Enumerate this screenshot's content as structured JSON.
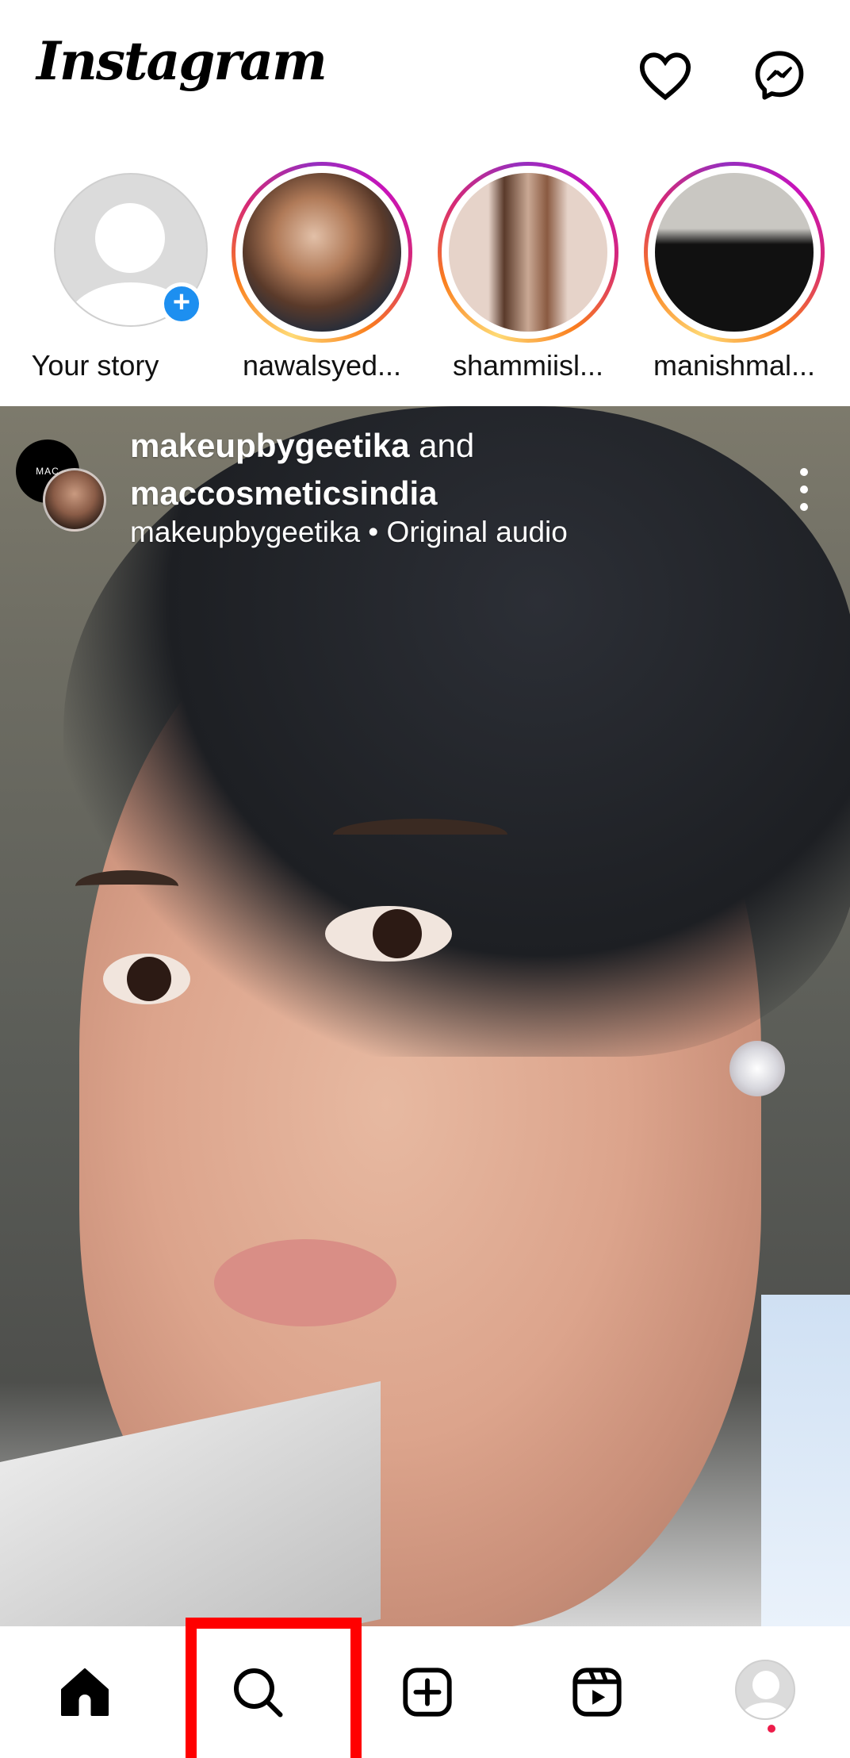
{
  "app": {
    "logo": "Instagram"
  },
  "header": {
    "icons": [
      "heart-icon",
      "messenger-icon"
    ]
  },
  "stories": [
    {
      "label": "Your story",
      "type": "own",
      "add_badge": "+"
    },
    {
      "label": "nawalsyed...",
      "type": "unseen",
      "photo_colors": [
        "#1b2a3d",
        "#b07a58",
        "#e2c0a8"
      ]
    },
    {
      "label": "shammiisl...",
      "type": "unseen",
      "photo_colors": [
        "#e6d3c9",
        "#8a5a41",
        "#c9a894"
      ]
    },
    {
      "label": "manishmal...",
      "type": "unseen",
      "photo_colors": [
        "#c9c7c2",
        "#f2f0ec",
        "#111111"
      ]
    }
  ],
  "post": {
    "author_primary": "makeupbygeetika",
    "joiner": "and",
    "author_secondary": "maccosmeticsindia",
    "audio_line": "makeupbygeetika • Original audio",
    "collab_logo_text": "MAC",
    "media_description": "Close-up video frame of a woman's face with hair pulled back and a diamond earring"
  },
  "bottom_nav": {
    "items": [
      {
        "name": "home",
        "icon": "home-icon",
        "active": true
      },
      {
        "name": "search",
        "icon": "search-icon",
        "active": false
      },
      {
        "name": "create",
        "icon": "add-post-icon",
        "active": false
      },
      {
        "name": "reels",
        "icon": "reels-icon",
        "active": false
      },
      {
        "name": "profile",
        "icon": "profile-avatar-icon",
        "active": false,
        "notification_dot": true
      }
    ]
  },
  "annotation": {
    "highlighted_item": "search",
    "color": "#ff0000"
  },
  "colors": {
    "story_ring": [
      "#feda75",
      "#fa7e1e",
      "#d62976",
      "#962fbf"
    ],
    "add_story_blue": "#1d8ff0",
    "notification_red": "#ed1c4a"
  }
}
